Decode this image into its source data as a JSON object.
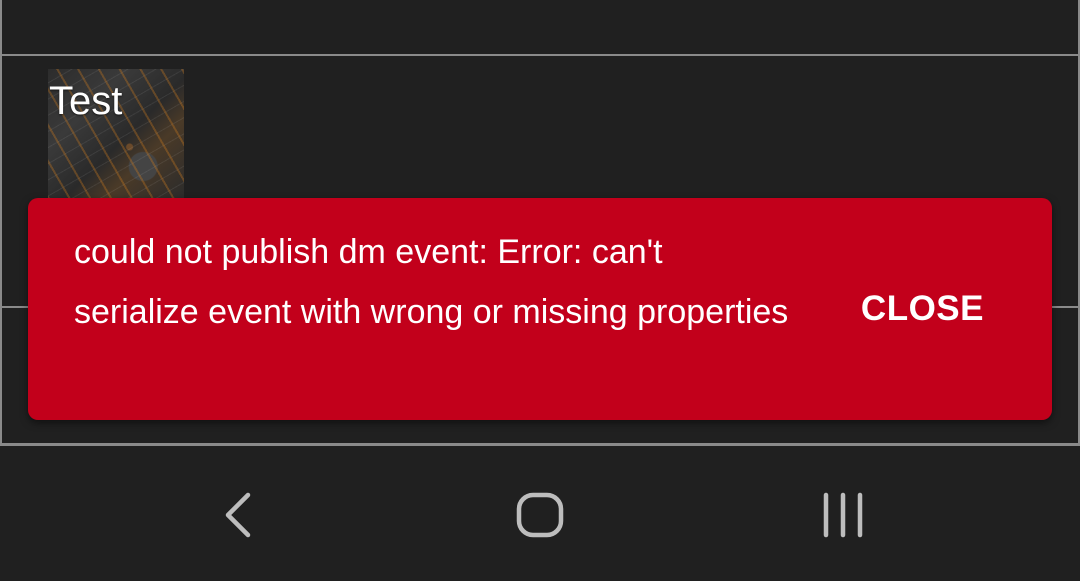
{
  "list": {
    "items": [
      {
        "title": "Test",
        "thumbnail": "image-thumbnail"
      }
    ]
  },
  "snackbar": {
    "message": "could not publish dm event: Error: can't serialize event with wrong or missing properties",
    "action_label": "CLOSE",
    "background_color": "#c2001b"
  },
  "nav_bar": {
    "back_icon": "chevron-left-icon",
    "home_icon": "rounded-square-icon",
    "recents_icon": "three-bars-icon"
  },
  "colors": {
    "background": "#202020",
    "divider": "#8a8a8a",
    "text": "#ffffff"
  }
}
